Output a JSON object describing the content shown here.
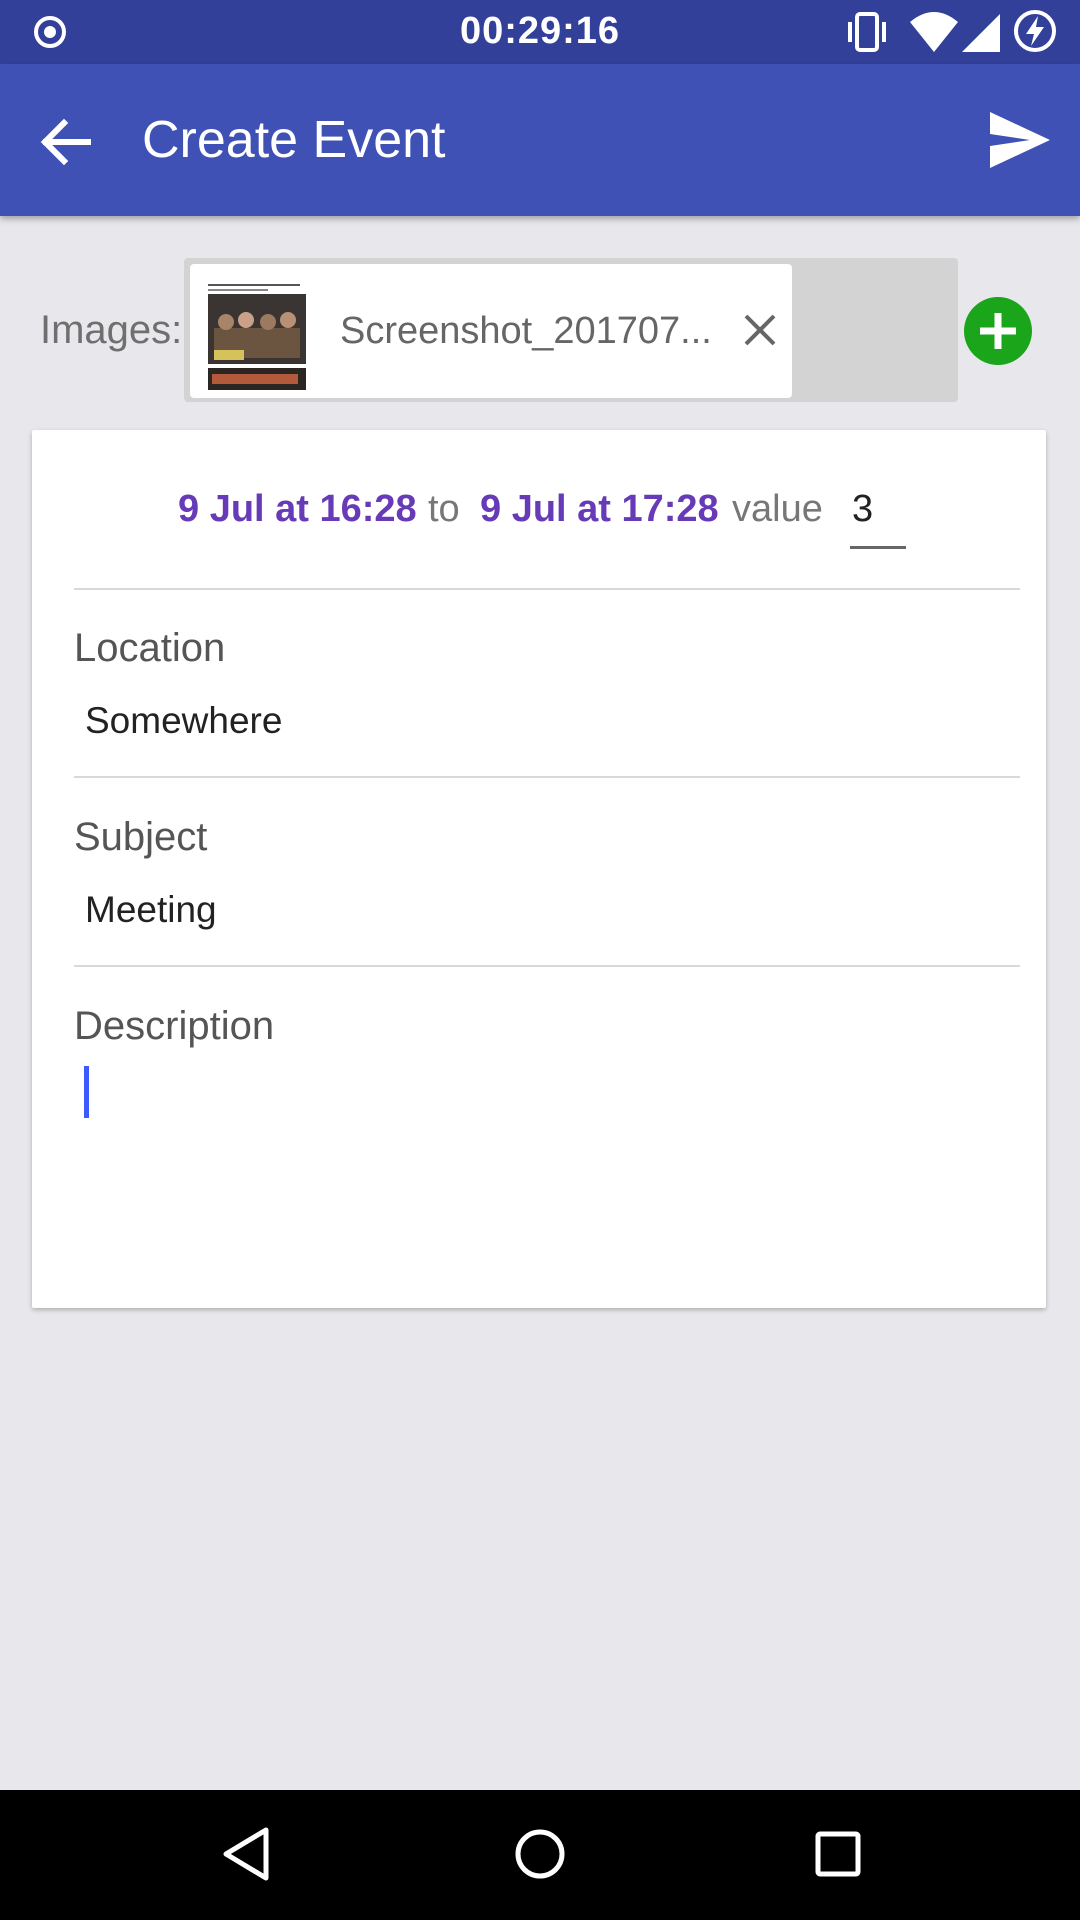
{
  "status_bar": {
    "time": "00:29:16"
  },
  "app_bar": {
    "title": "Create Event"
  },
  "images": {
    "label": "Images:",
    "attachments": [
      {
        "filename": "Screenshot_201707..."
      }
    ]
  },
  "event": {
    "start": "9 Jul at 16:28",
    "to_label": "to",
    "end": "9 Jul at 17:28",
    "value_label": "value",
    "value": "3"
  },
  "fields": {
    "location": {
      "label": "Location",
      "value": "Somewhere"
    },
    "subject": {
      "label": "Subject",
      "value": "Meeting"
    },
    "description": {
      "label": "Description",
      "value": ""
    }
  },
  "colors": {
    "status_bar": "#33409a",
    "app_bar": "#3f51b5",
    "date_accent": "#673ab7",
    "add_button": "#1aa51a"
  },
  "icons": [
    "record-icon",
    "vibrate-icon",
    "wifi-icon",
    "signal-icon",
    "battery-charging-icon",
    "back-arrow-icon",
    "send-icon",
    "close-icon",
    "add-icon",
    "nav-back-icon",
    "nav-home-icon",
    "nav-recents-icon"
  ]
}
